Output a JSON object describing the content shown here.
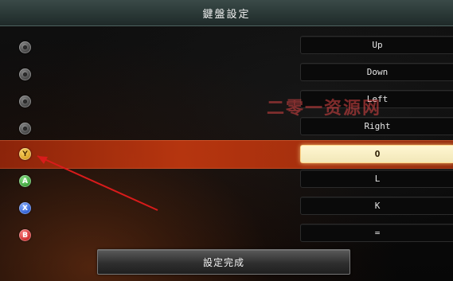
{
  "header": {
    "title": "鍵盤設定"
  },
  "rows": [
    {
      "icon_name": "button-placeholder-icon",
      "key": "Up"
    },
    {
      "icon_name": "button-placeholder-icon",
      "key": "Down"
    },
    {
      "icon_name": "button-placeholder-icon",
      "key": "Left"
    },
    {
      "icon_name": "button-placeholder-icon",
      "key": "Right"
    },
    {
      "icon_name": "y-button-icon",
      "icon_label": "Y",
      "key": "O",
      "selected": true
    },
    {
      "icon_name": "a-button-icon",
      "icon_label": "A",
      "key": "L"
    },
    {
      "icon_name": "x-button-icon",
      "icon_label": "X",
      "key": "K"
    },
    {
      "icon_name": "b-button-icon",
      "icon_label": "B",
      "key": "="
    }
  ],
  "footer": {
    "done_label": "設定完成"
  },
  "watermark": {
    "text": "二零一资源网"
  },
  "colors": {
    "highlight": "#c33a12",
    "active_key_bg": "#fff7d2",
    "arrow": "#d81b1b"
  }
}
